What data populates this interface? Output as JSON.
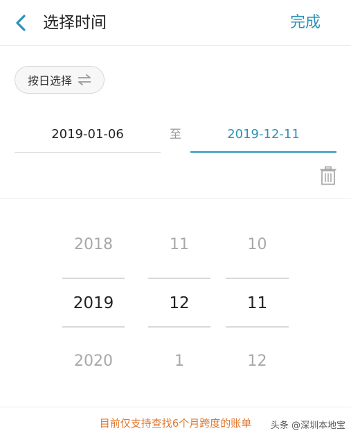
{
  "header": {
    "title": "选择时间",
    "done_label": "完成",
    "accent_color": "#2a92bb"
  },
  "mode": {
    "label": "按日选择",
    "icon": "swap-icon"
  },
  "range": {
    "start": "2019-01-06",
    "separator": "至",
    "end": "2019-12-11"
  },
  "picker": {
    "year": {
      "prev": "2018",
      "selected": "2019",
      "next": "2020"
    },
    "month": {
      "prev": "11",
      "selected": "12",
      "next": "1"
    },
    "day": {
      "prev": "10",
      "selected": "11",
      "next": "12"
    }
  },
  "notice": {
    "text": "目前仅支持查找6个月跨度的账单",
    "color": "#e2772f"
  },
  "watermark": {
    "text": "头条 @深圳本地宝"
  }
}
